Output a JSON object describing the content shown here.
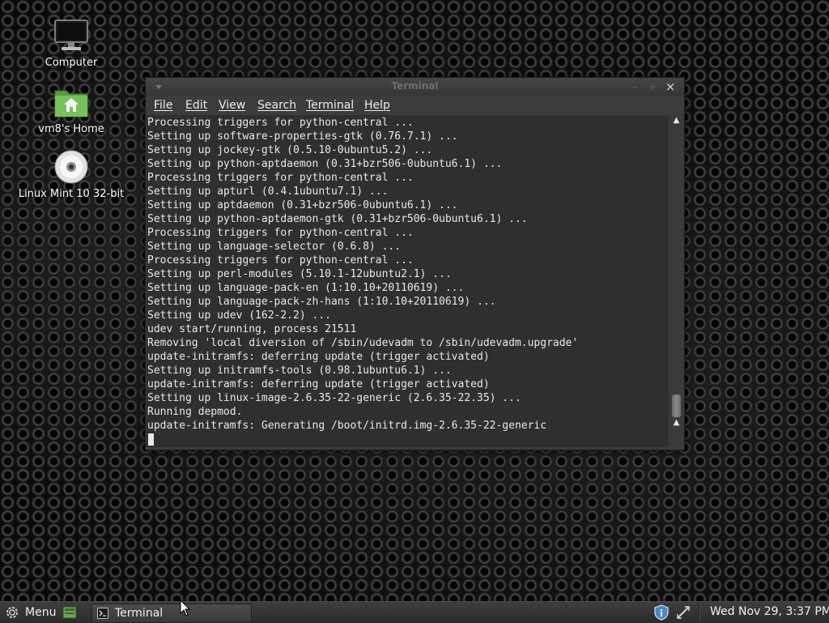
{
  "desktop": {
    "icons": [
      {
        "label": "Computer",
        "icon": "computer-icon"
      },
      {
        "label": "vm8's Home",
        "icon": "home-folder-icon"
      },
      {
        "label": "Linux Mint 10 32-bit",
        "icon": "cd-disc-icon"
      }
    ]
  },
  "window": {
    "title": "Terminal",
    "controls": {
      "minimize": "–",
      "maximize": "+",
      "close": "×"
    },
    "menu": [
      "File",
      "Edit",
      "View",
      "Search",
      "Terminal",
      "Help"
    ],
    "lines": [
      "Processing triggers for python-central ...",
      "Setting up software-properties-gtk (0.76.7.1) ...",
      "Setting up jockey-gtk (0.5.10-0ubuntu5.2) ...",
      "Setting up python-aptdaemon (0.31+bzr506-0ubuntu6.1) ...",
      "Processing triggers for python-central ...",
      "Setting up apturl (0.4.1ubuntu7.1) ...",
      "Setting up aptdaemon (0.31+bzr506-0ubuntu6.1) ...",
      "Setting up python-aptdaemon-gtk (0.31+bzr506-0ubuntu6.1) ...",
      "Processing triggers for python-central ...",
      "Setting up language-selector (0.6.8) ...",
      "Processing triggers for python-central ...",
      "Setting up perl-modules (5.10.1-12ubuntu2.1) ...",
      "Setting up language-pack-en (1:10.10+20110619) ...",
      "Setting up language-pack-zh-hans (1:10.10+20110619) ...",
      "Setting up udev (162-2.2) ...",
      "udev start/running, process 21511",
      "Removing 'local diversion of /sbin/udevadm to /sbin/udevadm.upgrade'",
      "update-initramfs: deferring update (trigger activated)",
      "Setting up initramfs-tools (0.98.1ubuntu6.1) ...",
      "update-initramfs: deferring update (trigger activated)",
      "Setting up linux-image-2.6.35-22-generic (2.6.35-22.35) ...",
      "Running depmod.",
      "update-initramfs: Generating /boot/initrd.img-2.6.35-22-generic"
    ]
  },
  "taskbar": {
    "menu_label": "Menu",
    "task_label": "Terminal",
    "clock": "Wed Nov 29,  3:37 PM"
  },
  "colors": {
    "terminal_bg": "#2f2f2f",
    "terminal_fg": "#e8e8e8",
    "menubar_bg": "#3c3c3c",
    "panel_bg": "#333333",
    "home_folder_green": "#6ab04c"
  }
}
